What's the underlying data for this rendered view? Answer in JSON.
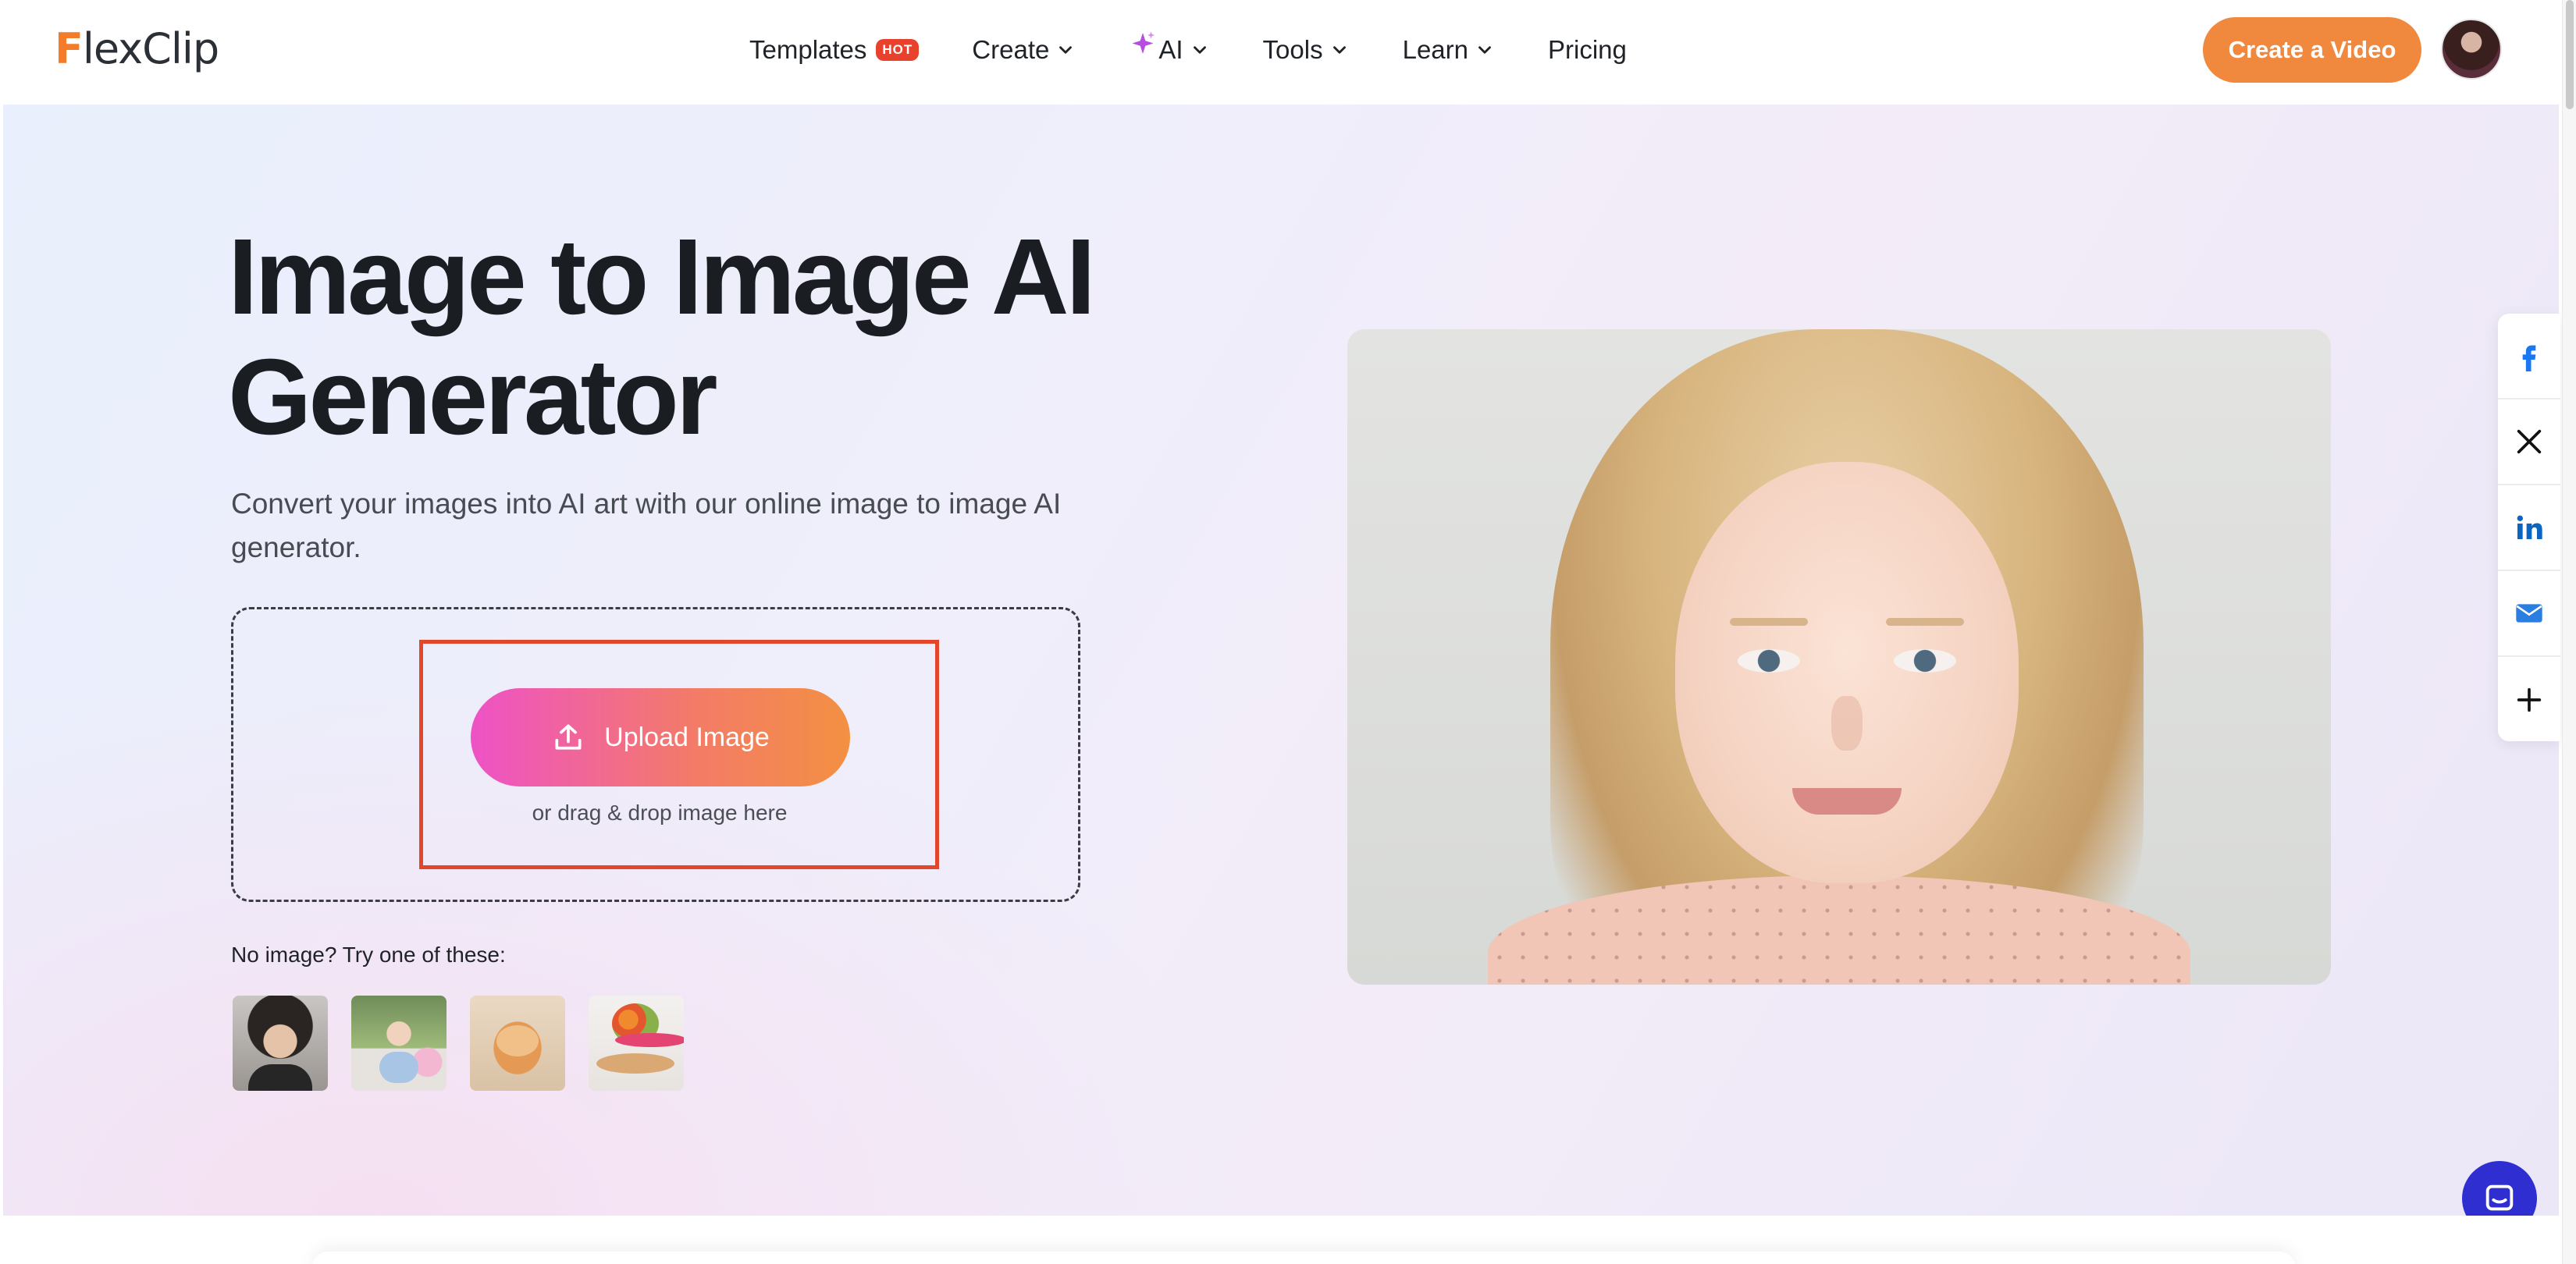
{
  "brand": {
    "logo_text_1": "F",
    "logo_text_2": "lexClip"
  },
  "nav": {
    "templates": "Templates",
    "hot_badge": "HOT",
    "create": "Create",
    "ai": "AI",
    "tools": "Tools",
    "learn": "Learn",
    "pricing": "Pricing",
    "cta": "Create a Video"
  },
  "hero": {
    "title_line1": "Image to Image AI",
    "title_line2": "Generator",
    "subtitle": "Convert your images into AI art with our online image to image AI generator.",
    "upload_label": "Upload Image",
    "drag_text": "or drag & drop image here",
    "samples_label": "No image? Try one of these:"
  },
  "colors": {
    "accent_orange": "#f0883e",
    "hot_red": "#e8412e",
    "upload_gradient_start": "#ee52c6",
    "upload_gradient_end": "#f39042",
    "highlight_red": "#e2472b",
    "chat_blue": "#2f2fd1"
  },
  "icons": {
    "share": [
      "facebook-icon",
      "x-icon",
      "linkedin-icon",
      "mail-icon",
      "plus-icon"
    ],
    "upload": "upload-icon",
    "chat": "chat-icon"
  }
}
